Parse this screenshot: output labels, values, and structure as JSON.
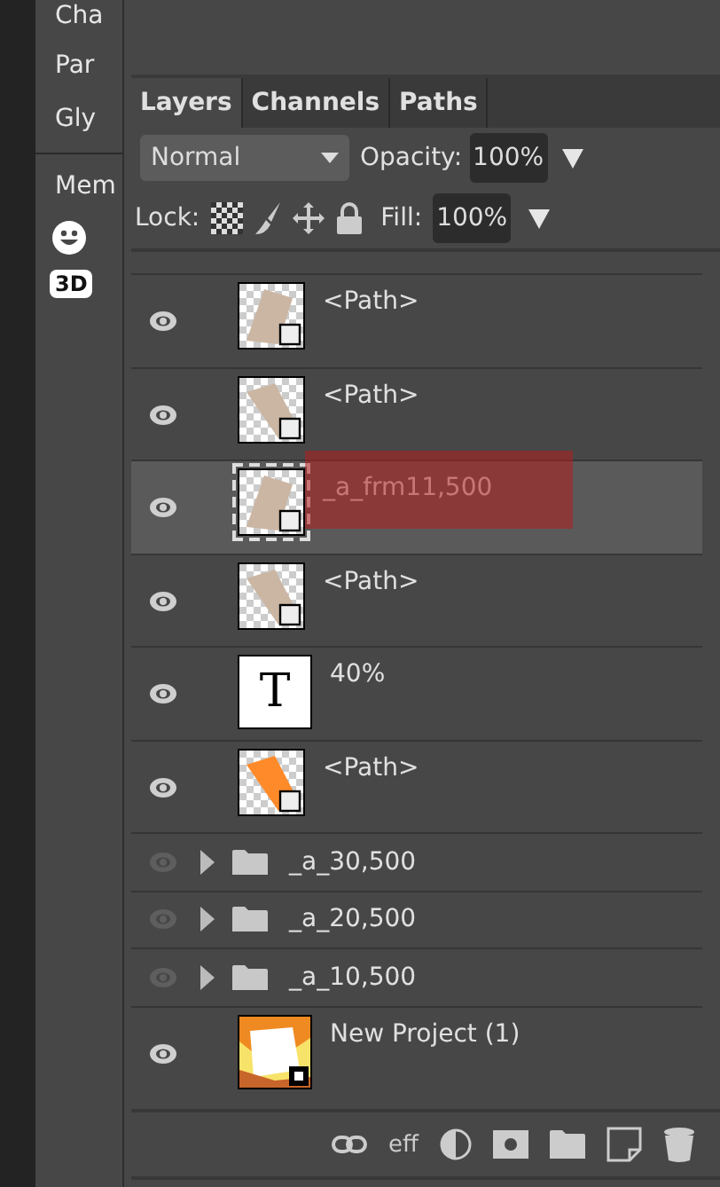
{
  "sidebar": {
    "items": [
      {
        "label": "Cha",
        "kind": "text"
      },
      {
        "label": "Par",
        "kind": "text"
      },
      {
        "label": "Gly",
        "kind": "text"
      },
      {
        "label": "Mem",
        "kind": "text"
      },
      {
        "kind": "emoji"
      },
      {
        "label": "3D",
        "kind": "badge"
      }
    ]
  },
  "tabs": [
    {
      "label": "Layers",
      "selected": true
    },
    {
      "label": "Channels",
      "selected": false
    },
    {
      "label": "Paths",
      "selected": false
    }
  ],
  "blend_mode": "Normal",
  "opacity": {
    "label": "Opacity:",
    "value": "100%"
  },
  "lock": {
    "label": "Lock:"
  },
  "fill": {
    "label": "Fill:",
    "value": "100%"
  },
  "layers": [
    {
      "kind": "path",
      "name": "<Path>",
      "visible": true,
      "selected": false,
      "color": "#cbb6a3"
    },
    {
      "kind": "path",
      "name": "<Path>",
      "visible": true,
      "selected": false,
      "color": "#cbb6a3"
    },
    {
      "kind": "path",
      "name": "_a_frm11,500",
      "visible": true,
      "selected": true,
      "color": "#cbb6a3",
      "dragging": true
    },
    {
      "kind": "path",
      "name": "<Path>",
      "visible": true,
      "selected": false,
      "color": "#cbb6a3"
    },
    {
      "kind": "text",
      "name": "40%",
      "visible": true,
      "selected": false,
      "thumb_text": "T"
    },
    {
      "kind": "path",
      "name": "<Path>",
      "visible": true,
      "selected": false,
      "color": "#ff8a2a"
    },
    {
      "kind": "folder",
      "name": "_a_30,500",
      "visible": false,
      "selected": false,
      "expanded": false
    },
    {
      "kind": "folder",
      "name": "_a_20,500",
      "visible": false,
      "selected": false,
      "expanded": false
    },
    {
      "kind": "folder",
      "name": "_a_10,500",
      "visible": false,
      "selected": false,
      "expanded": false
    },
    {
      "name": "New Project (1)",
      "visible": true,
      "selected": false
    }
  ],
  "footer": {
    "effects_label": "eff"
  }
}
